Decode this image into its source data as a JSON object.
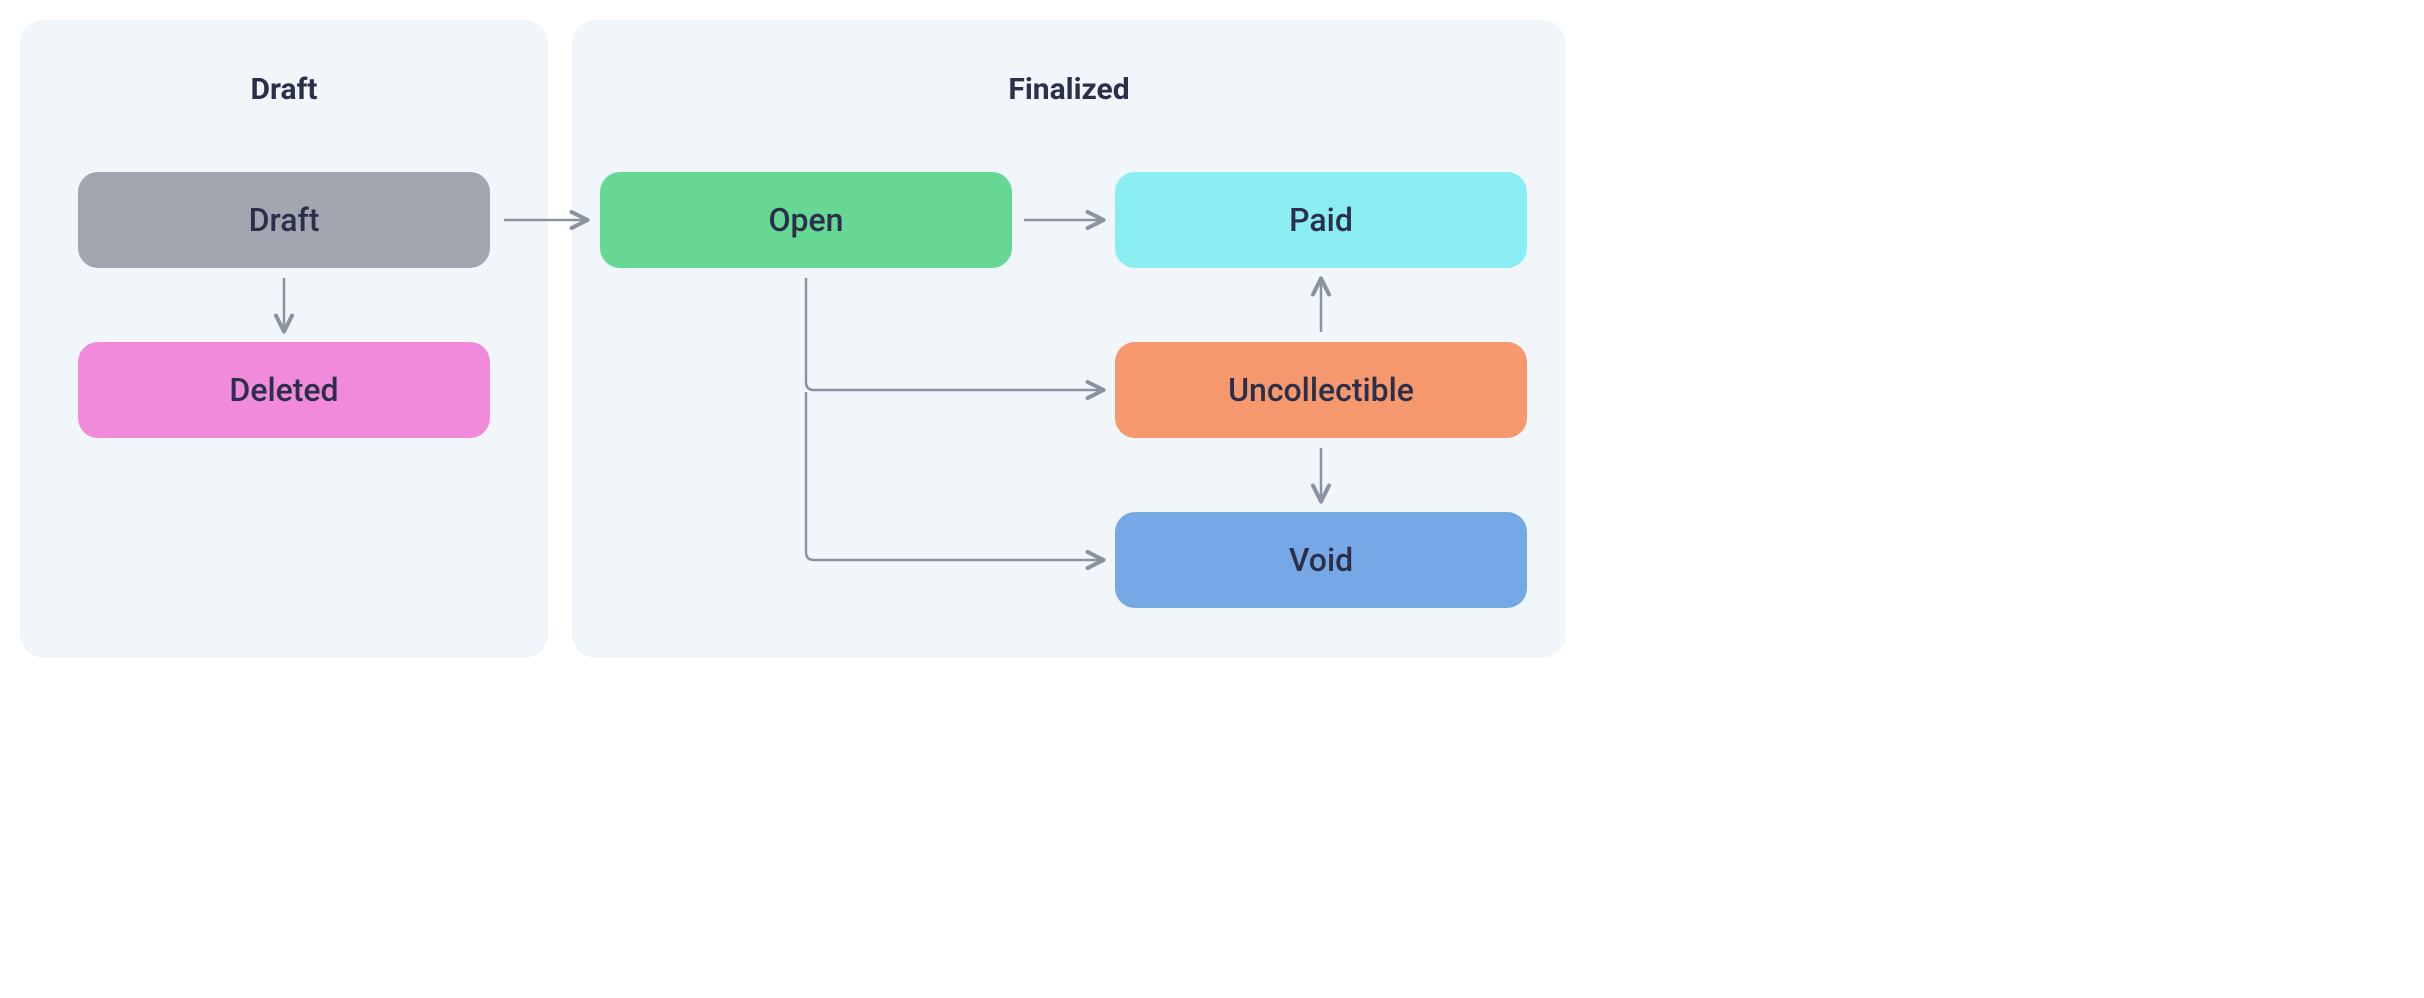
{
  "sections": {
    "draft": {
      "title": "Draft"
    },
    "finalized": {
      "title": "Finalized"
    }
  },
  "states": {
    "draft": {
      "label": "Draft",
      "bg": "#a1a6b0"
    },
    "deleted": {
      "label": "Deleted",
      "bg": "#f18adb"
    },
    "open": {
      "label": "Open",
      "bg": "#67d794"
    },
    "paid": {
      "label": "Paid",
      "bg": "#89edf2"
    },
    "uncollectible": {
      "label": "Uncollectible",
      "bg": "#f6986d"
    },
    "void": {
      "label": "Void",
      "bg": "#77a8e6"
    }
  },
  "colors": {
    "panel_bg": "#f1f6fa",
    "text": "#2b2f4a",
    "arrow": "#8c93a0"
  }
}
